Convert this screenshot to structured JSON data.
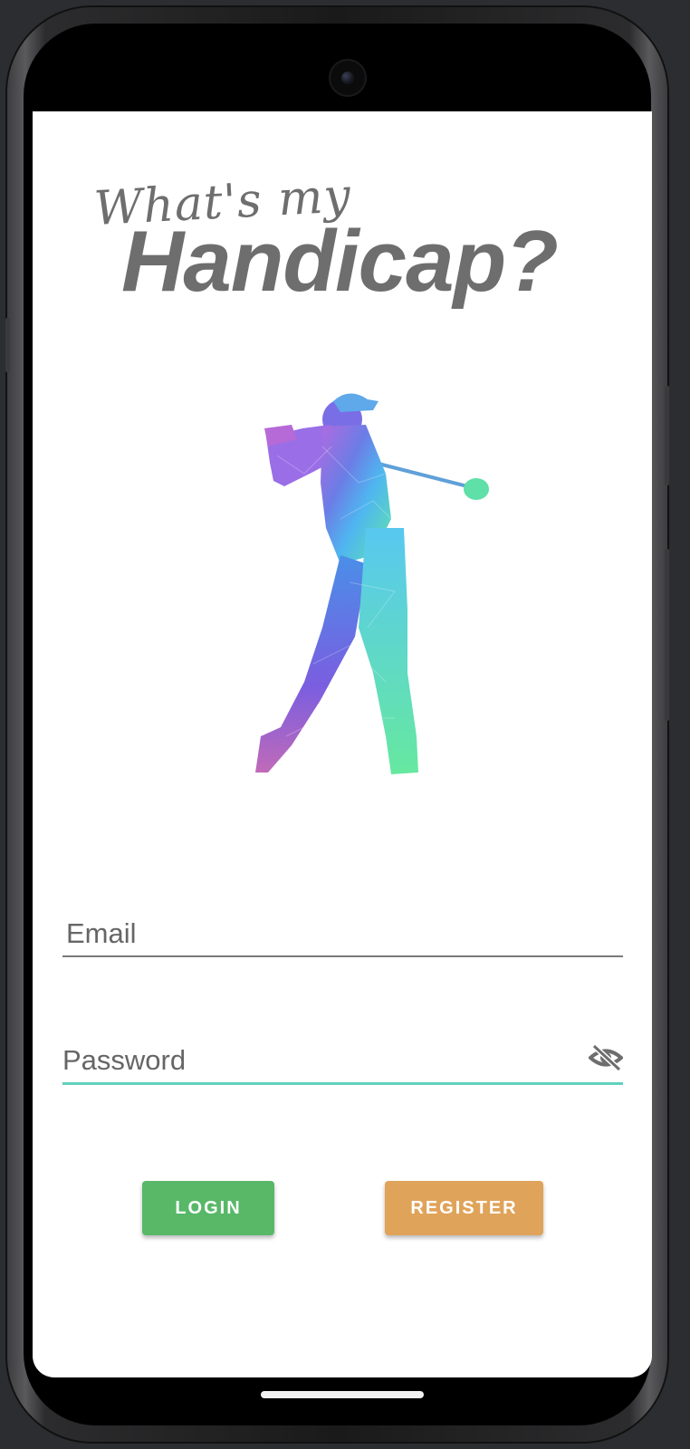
{
  "logo": {
    "line1": "What's my",
    "line2": "Handicap?"
  },
  "login_form": {
    "email": {
      "placeholder": "Email",
      "value": ""
    },
    "password": {
      "placeholder": "Password",
      "value": ""
    }
  },
  "actions": {
    "login_label": "LOGIN",
    "register_label": "REGISTER"
  },
  "colors": {
    "accent": "#62d1bd",
    "login_button": "#58b868",
    "register_button": "#e0a35a",
    "logo_text": "#6e6e6e"
  },
  "icons": {
    "illustration": "golfer-illustration-icon",
    "password_toggle": "eye-off-icon"
  }
}
